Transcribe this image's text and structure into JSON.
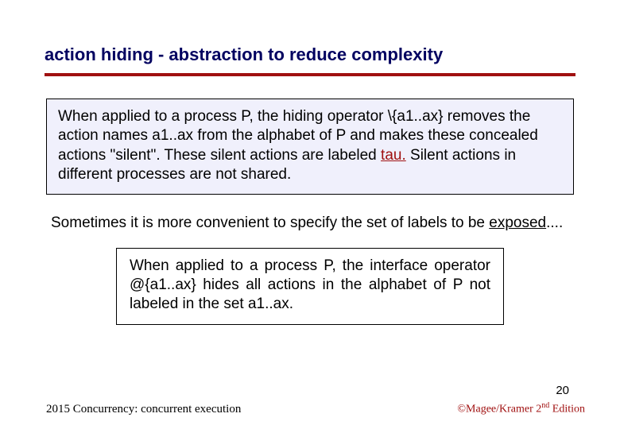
{
  "title": "action hiding - abstraction to reduce complexity",
  "box1": {
    "part1": "When applied to a process P, the hiding operator \\{a1..ax} removes the action names a1..ax from the alphabet of P and makes these concealed actions \"silent\". These silent actions are labeled ",
    "tau": "tau.",
    "part2": "  Silent actions in different processes are not shared."
  },
  "midtext": {
    "part1": "Sometimes it is more convenient to specify the set of labels to be ",
    "exposed": "exposed",
    "part2": "...."
  },
  "box2": "When applied to a process P, the interface operator @{a1..ax} hides all actions in the alphabet of P not labeled in the set a1..ax.",
  "pagenum": "20",
  "footer_left": "2015  Concurrency: concurrent execution",
  "footer_right": {
    "p1": "©Magee/Kramer ",
    "p2": "2",
    "nd": "nd",
    "p3": " Edition"
  }
}
